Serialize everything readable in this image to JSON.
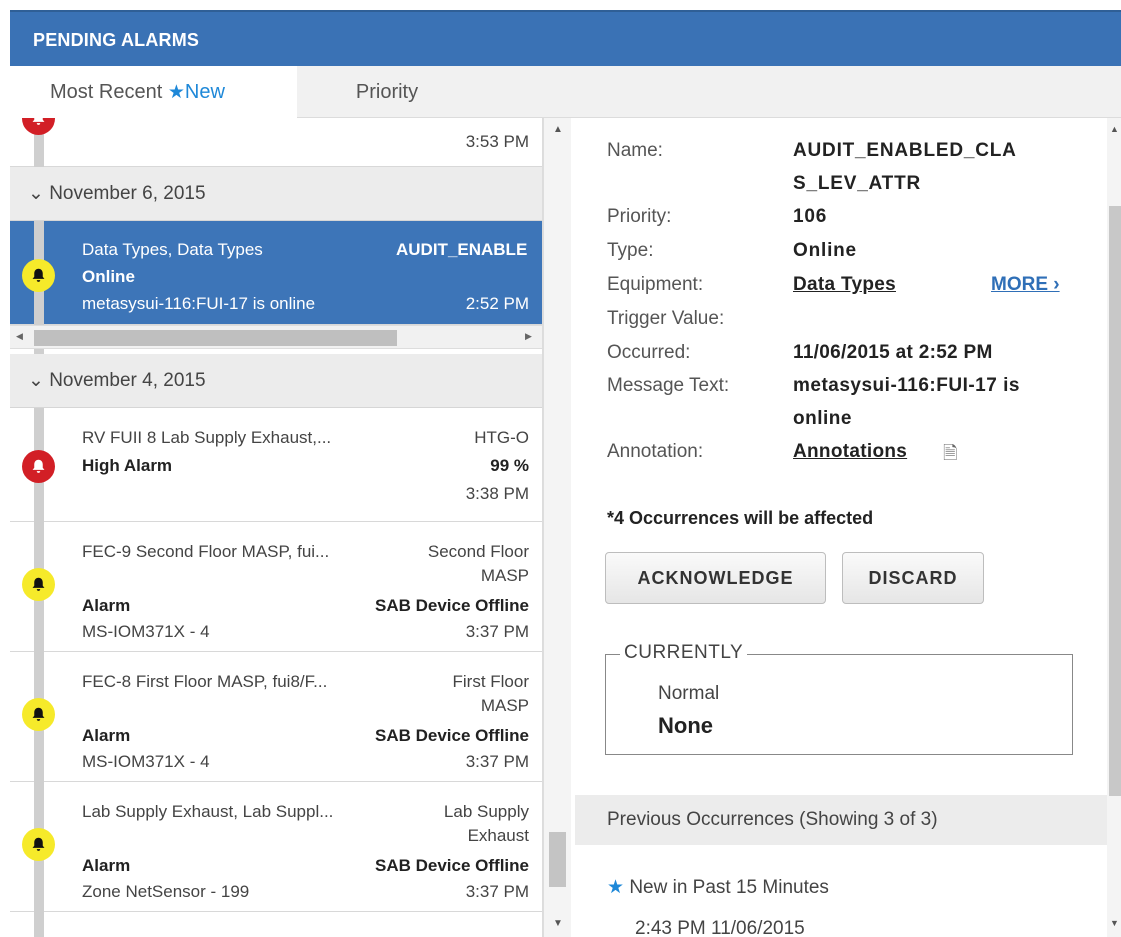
{
  "header": {
    "title": "PENDING ALARMS"
  },
  "tabs": {
    "most_recent": "Most Recent",
    "new_label": "New",
    "priority": "Priority"
  },
  "list": {
    "top_partial": {
      "time": "3:53 PM"
    },
    "groups": [
      {
        "date": "November 6, 2015",
        "items": [
          {
            "name": "Data Types, Data Types",
            "state": "Online",
            "message": "metasysui-116:FUI-17 is online",
            "right1": "AUDIT_ENABLE",
            "time": "2:52 PM",
            "color": "#f6ea2a"
          }
        ]
      },
      {
        "date": "November 4, 2015",
        "items": [
          {
            "name": "RV FUII 8 Lab Supply Exhaust,...",
            "state": "High Alarm",
            "right1": "HTG-O",
            "right2": "99 %",
            "time": "3:38 PM",
            "color": "#d21f26"
          },
          {
            "name": "FEC-9 Second Floor MASP, fui...",
            "right1": "Second Floor",
            "right2": "MASP",
            "state": "Alarm",
            "status": "SAB Device Offline",
            "device": "MS-IOM371X - 4",
            "time": "3:37 PM",
            "color": "#f6ea2a"
          },
          {
            "name": "FEC-8 First Floor MASP, fui8/F...",
            "right1": "First Floor",
            "right2": "MASP",
            "state": "Alarm",
            "status": "SAB Device Offline",
            "device": "MS-IOM371X - 4",
            "time": "3:37 PM",
            "color": "#f6ea2a"
          },
          {
            "name": "Lab Supply Exhaust, Lab Suppl...",
            "right1": "Lab Supply",
            "right2": "Exhaust",
            "state": "Alarm",
            "status": "SAB Device Offline",
            "device": "Zone NetSensor - 199",
            "time": "3:37 PM",
            "color": "#f6ea2a"
          }
        ]
      }
    ]
  },
  "detail": {
    "name_label": "Name:",
    "name_line1": "AUDIT_ENABLED_CLA",
    "name_line2": "S_LEV_ATTR",
    "priority_label": "Priority:",
    "priority": "106",
    "type_label": "Type:",
    "type": "Online",
    "equipment_label": "Equipment:",
    "equipment": "Data Types",
    "more": "MORE",
    "trigger_label": "Trigger Value:",
    "occurred_label": "Occurred:",
    "occurred": "11/06/2015 at 2:52 PM",
    "message_label": "Message Text:",
    "message_line1": "metasysui-116:FUI-17 is",
    "message_line2": "online",
    "annotation_label": "Annotation:",
    "annotation": "Annotations",
    "affected": "*4 Occurrences will be affected",
    "acknowledge": "ACKNOWLEDGE",
    "discard": "DISCARD",
    "currently_legend": "CURRENTLY",
    "currently_state": "Normal",
    "currently_value": "None",
    "previous_header": "Previous Occurrences (Showing 3 of 3)",
    "previous_new": "New in Past 15 Minutes",
    "previous_item": "2:43 PM 11/06/2015"
  },
  "colors": {
    "header_bg": "#3a72b5",
    "selected_bg": "#3d75b8",
    "accent_blue": "#1e88d8",
    "link": "#2f6fb7",
    "alarm_yellow": "#f6ea2a",
    "alarm_red": "#d21f26"
  }
}
